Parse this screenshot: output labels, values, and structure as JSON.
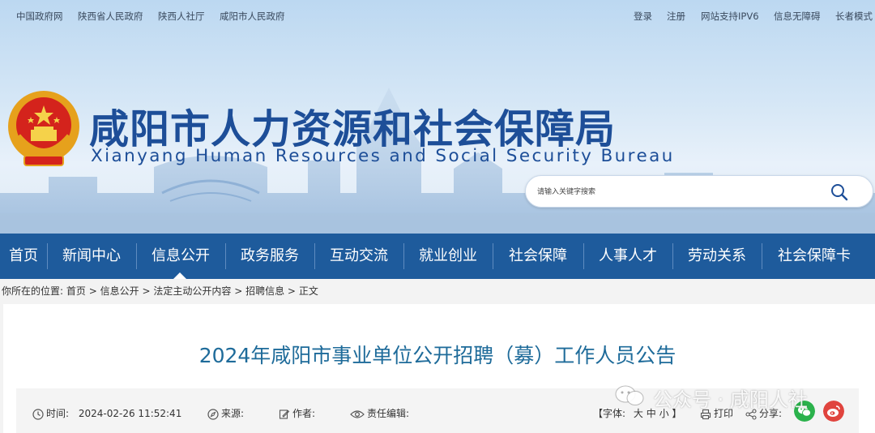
{
  "toplinks": {
    "left": [
      "中国政府网",
      "陕西省人民政府",
      "陕西人社厅",
      "咸阳市人民政府"
    ],
    "right": [
      "登录",
      "注册",
      "网站支持IPV6",
      "信息无障碍",
      "长者模式"
    ]
  },
  "header": {
    "title_cn": "咸阳市人力资源和社会保障局",
    "title_en": "Xianyang Human Resources and Social Security Bureau"
  },
  "search": {
    "placeholder": "请输入关键字搜索"
  },
  "nav": {
    "items": [
      "首页",
      "新闻中心",
      "信息公开",
      "政务服务",
      "互动交流",
      "就业创业",
      "社会保障",
      "人事人才",
      "劳动关系",
      "社会保障卡"
    ],
    "active": "信息公开"
  },
  "breadcrumb": {
    "prefix": "你所在的位置:",
    "path": [
      "首页",
      "信息公开",
      "法定主动公开内容",
      "招聘信息",
      "正文"
    ],
    "separator": ">"
  },
  "article": {
    "title": "2024年咸阳市事业单位公开招聘（募）工作人员公告",
    "time_label": "时间:",
    "time_value": "2024-02-26 11:52:41",
    "source_label": "来源:",
    "author_label": "作者:",
    "editor_label": "责任编辑:",
    "font_label": "【字体:",
    "font_sizes": [
      "大",
      "中",
      "小"
    ],
    "font_close": "】",
    "print_label": "打印",
    "share_label": "分享:"
  },
  "watermark": {
    "text": "公众号 · 咸阳人社"
  },
  "colors": {
    "nav_bg": "#1e5b9c",
    "title_blue": "#1d4e98",
    "article_title": "#1e6b9a",
    "wechat_green": "#2bb24c",
    "weibo_red": "#e0443e"
  }
}
